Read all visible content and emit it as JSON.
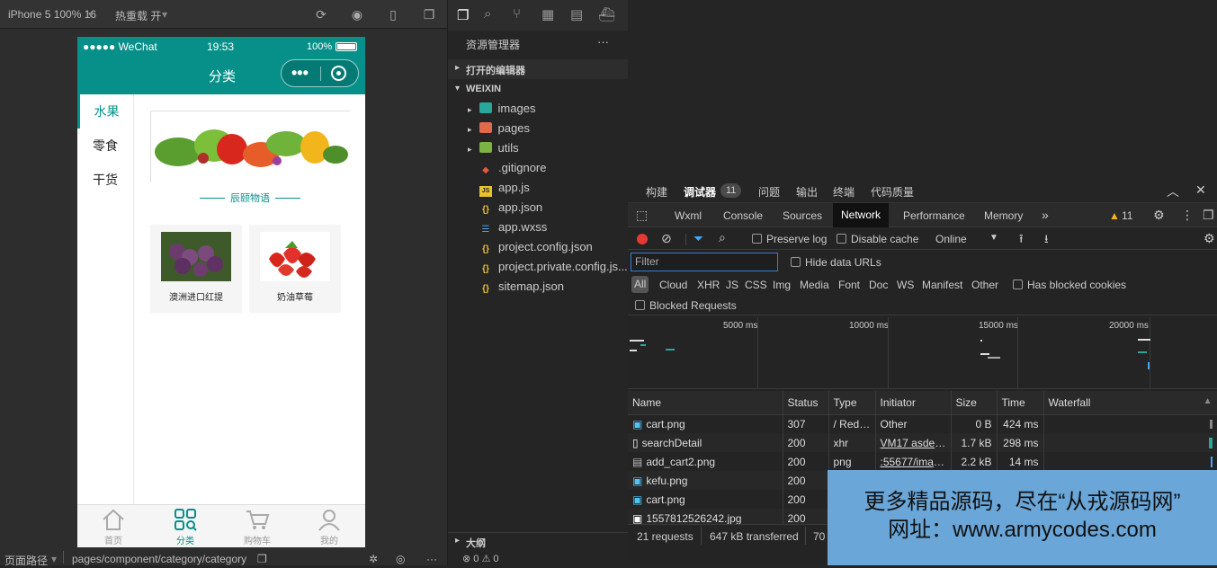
{
  "simulator": {
    "device": "iPhone 5 100% 16",
    "hot_reload": "热重载 开",
    "status_carrier": "●●●●● WeChat",
    "status_time": "19:53",
    "status_battery": "100%",
    "nav_title": "分类",
    "capsule_dots": "•••",
    "categories": [
      "水果",
      "零食",
      "干货"
    ],
    "banner_caption": "辰颐物语",
    "products": [
      {
        "name": "澳洲进口红提"
      },
      {
        "name": "奶油草莓"
      }
    ],
    "tabs": [
      "首页",
      "分类",
      "购物车",
      "我的"
    ],
    "page_path_label": "页面路径",
    "page_path": "pages/component/category/category"
  },
  "explorer": {
    "title": "资源管理器",
    "more": "···",
    "open_editors": "打开的编辑器",
    "project": "WEIXIN",
    "files": [
      {
        "name": "images",
        "type": "folder"
      },
      {
        "name": "pages",
        "type": "folder"
      },
      {
        "name": "utils",
        "type": "folder"
      },
      {
        "name": ".gitignore",
        "type": "git"
      },
      {
        "name": "app.js",
        "type": "js"
      },
      {
        "name": "app.json",
        "type": "json"
      },
      {
        "name": "app.wxss",
        "type": "css"
      },
      {
        "name": "project.config.json",
        "type": "json"
      },
      {
        "name": "project.private.config.js...",
        "type": "json"
      },
      {
        "name": "sitemap.json",
        "type": "json"
      }
    ],
    "outline": "大纲",
    "problems": "⊗ 0 ⚠ 0"
  },
  "devtools": {
    "top_tabs": [
      "构建",
      "调试器",
      "问题",
      "输出",
      "终端",
      "代码质量"
    ],
    "debugger_badge": "11",
    "panel_tabs": [
      "Wxml",
      "Console",
      "Sources",
      "Network",
      "Performance",
      "Memory"
    ],
    "warning_count": "11",
    "preserve_log": "Preserve log",
    "disable_cache": "Disable cache",
    "throttle": "Online",
    "filter_placeholder": "Filter",
    "hide_data_urls": "Hide data URLs",
    "type_filters": [
      "All",
      "Cloud",
      "XHR",
      "JS",
      "CSS",
      "Img",
      "Media",
      "Font",
      "Doc",
      "WS",
      "Manifest",
      "Other"
    ],
    "has_blocked_cookies": "Has blocked cookies",
    "blocked_requests": "Blocked Requests",
    "timeline_ticks": [
      "5000 ms",
      "10000 ms",
      "15000 ms",
      "20000 ms"
    ],
    "columns": [
      "Name",
      "Status",
      "Type",
      "Initiator",
      "Size",
      "Time",
      "Waterfall"
    ],
    "rows": [
      {
        "name": "cart.png",
        "status": "307",
        "type": "/ Redi...",
        "initiator": "Other",
        "size": "0 B",
        "time": "424 ms"
      },
      {
        "name": "searchDetail",
        "status": "200",
        "type": "xhr",
        "initiator": "VM17 asdeb...",
        "size": "1.7 kB",
        "time": "298 ms"
      },
      {
        "name": "add_cart2.png",
        "status": "200",
        "type": "png",
        "initiator": ":55677/imag...",
        "size": "2.2 kB",
        "time": "14 ms"
      },
      {
        "name": "kefu.png",
        "status": "200",
        "type": "",
        "initiator": "",
        "size": "",
        "time": ""
      },
      {
        "name": "cart.png",
        "status": "200",
        "type": "",
        "initiator": "",
        "size": "",
        "time": ""
      },
      {
        "name": "1557812526242.jpg",
        "status": "200",
        "type": "",
        "initiator": "",
        "size": "",
        "time": ""
      }
    ],
    "summary_requests": "21 requests",
    "summary_transferred": "647 kB transferred",
    "summary_more": "70"
  },
  "watermark": {
    "line1": "更多精品源码，尽在“从戎源码网”",
    "line2": "网址：www.armycodes.com"
  },
  "colors": {
    "accent": "#07908a",
    "record": "#e53935",
    "watermark_bg": "#6aa6d8"
  }
}
